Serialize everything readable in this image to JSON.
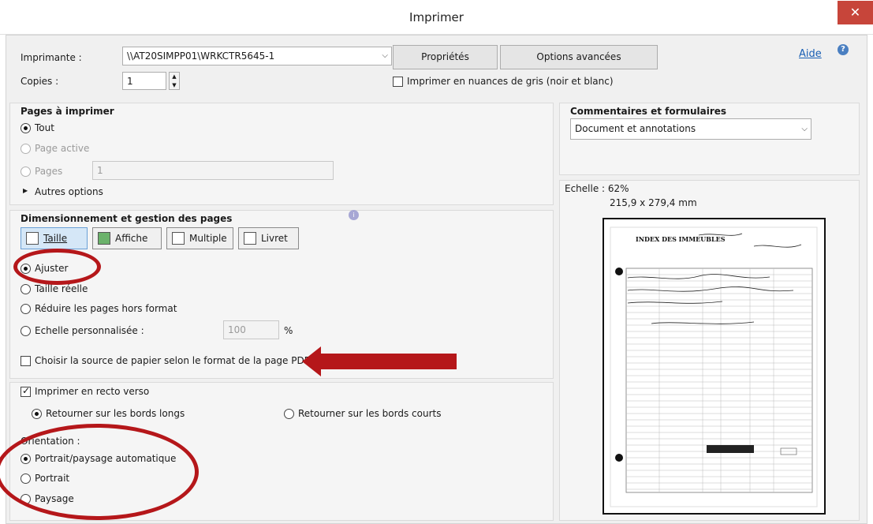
{
  "window": {
    "title": "Imprimer",
    "close_glyph": "✕"
  },
  "printer": {
    "label": "Imprimante :",
    "value": "\\\\AT20SIMPP01\\WRKCTR5645-1",
    "properties": "Propriétés",
    "advanced": "Options avancées",
    "help": "Aide"
  },
  "copies": {
    "label": "Copies :",
    "value": "1"
  },
  "grayscale": {
    "label": "Imprimer en nuances de gris (noir et blanc)",
    "checked": false
  },
  "pages": {
    "title": "Pages à imprimer",
    "all": "Tout",
    "current": "Page active",
    "range_label": "Pages",
    "range_value": "1",
    "more": "Autres options"
  },
  "sizing": {
    "title": "Dimensionnement et gestion des pages",
    "tabs": [
      "Taille",
      "Affiche",
      "Multiple",
      "Livret"
    ],
    "fit": "Ajuster",
    "actual": "Taille réelle",
    "shrink": "Réduire les pages hors format",
    "custom": "Echelle personnalisée :",
    "custom_value": "100",
    "percent": "%",
    "paper_source": "Choisir la source de papier selon le format de la page PDF"
  },
  "duplex": {
    "label": "Imprimer en recto verso",
    "checked": true,
    "long": "Retourner sur les bords longs",
    "short": "Retourner sur les bords courts"
  },
  "orientation": {
    "label": "Orientation :",
    "auto": "Portrait/paysage automatique",
    "portrait": "Portrait",
    "landscape": "Paysage"
  },
  "comments": {
    "title": "Commentaires et formulaires",
    "value": "Document et annotations"
  },
  "preview": {
    "scale": "Echelle : 62%",
    "size": "215,9 x 279,4 mm",
    "doc_heading": "INDEX DES IMMEUBLES"
  },
  "colors": {
    "accent_red": "#b5171a",
    "close_red": "#c7453a",
    "tab_selected": "#d5e7f7"
  }
}
